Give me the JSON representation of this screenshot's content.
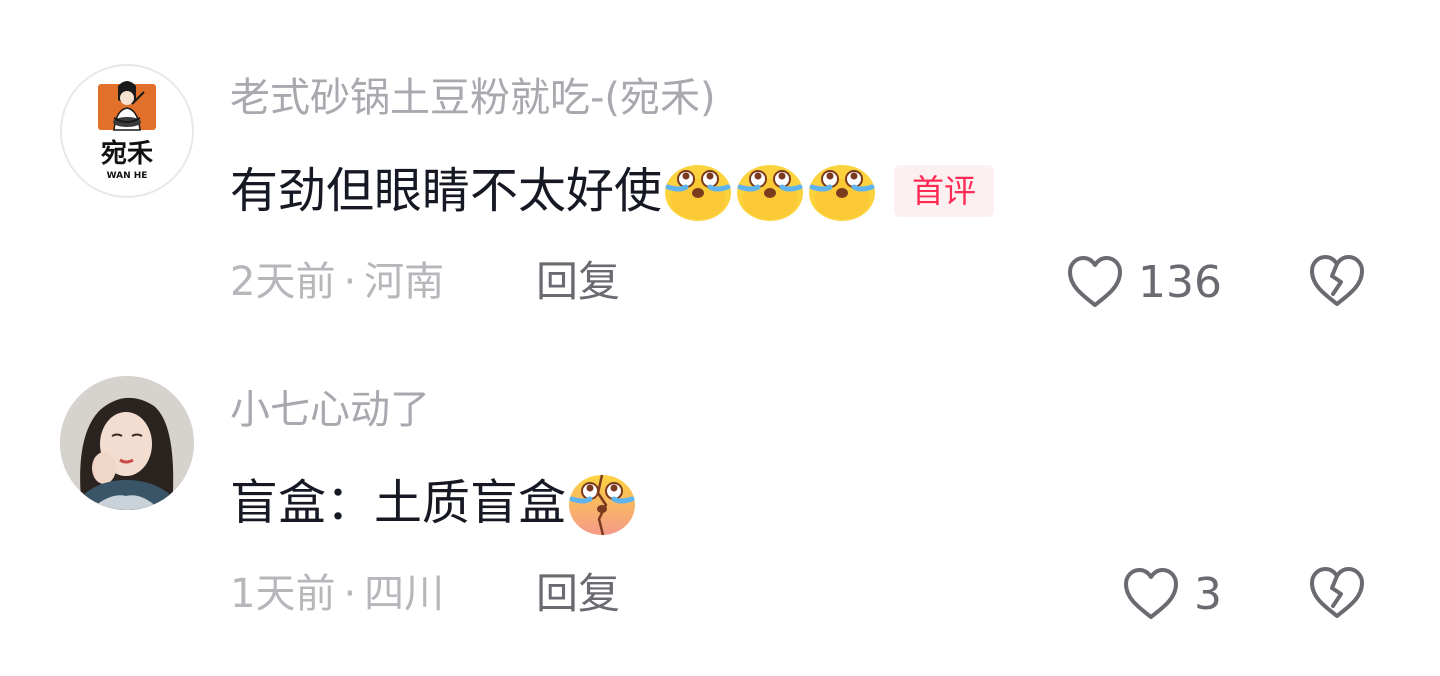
{
  "comments": [
    {
      "username": "老式砂锅土豆粉就吃-(宛禾)",
      "avatar": {
        "type": "brand-logo",
        "icon": "wanhe-logo-icon",
        "brand_text": "宛禾",
        "brand_subtext": "WAN HE"
      },
      "text": "有劲但眼睛不太好使",
      "emojis": [
        "crying-emoji-icon",
        "crying-emoji-icon",
        "crying-emoji-icon"
      ],
      "tag": "首评",
      "time": "2天前",
      "separator": "·",
      "location": "河南",
      "reply_label": "回复",
      "likes": "136"
    },
    {
      "username": "小七心动了",
      "avatar": {
        "type": "photo",
        "icon": "user-photo-avatar"
      },
      "text": "盲盒：土质盲盒",
      "emojis": [
        "heartbroken-crying-emoji-icon"
      ],
      "tag": "",
      "time": "1天前",
      "separator": "·",
      "location": "四川",
      "reply_label": "回复",
      "likes": "3"
    }
  ],
  "colors": {
    "username": "#a8a9ae",
    "text": "#161823",
    "meta": "#b6b7bb",
    "action": "#6a6b71",
    "tag_text": "#fe2c55",
    "tag_bg": "#fdf0f1"
  },
  "icons": {
    "like": "heart-outline-icon",
    "dislike": "broken-heart-icon"
  }
}
